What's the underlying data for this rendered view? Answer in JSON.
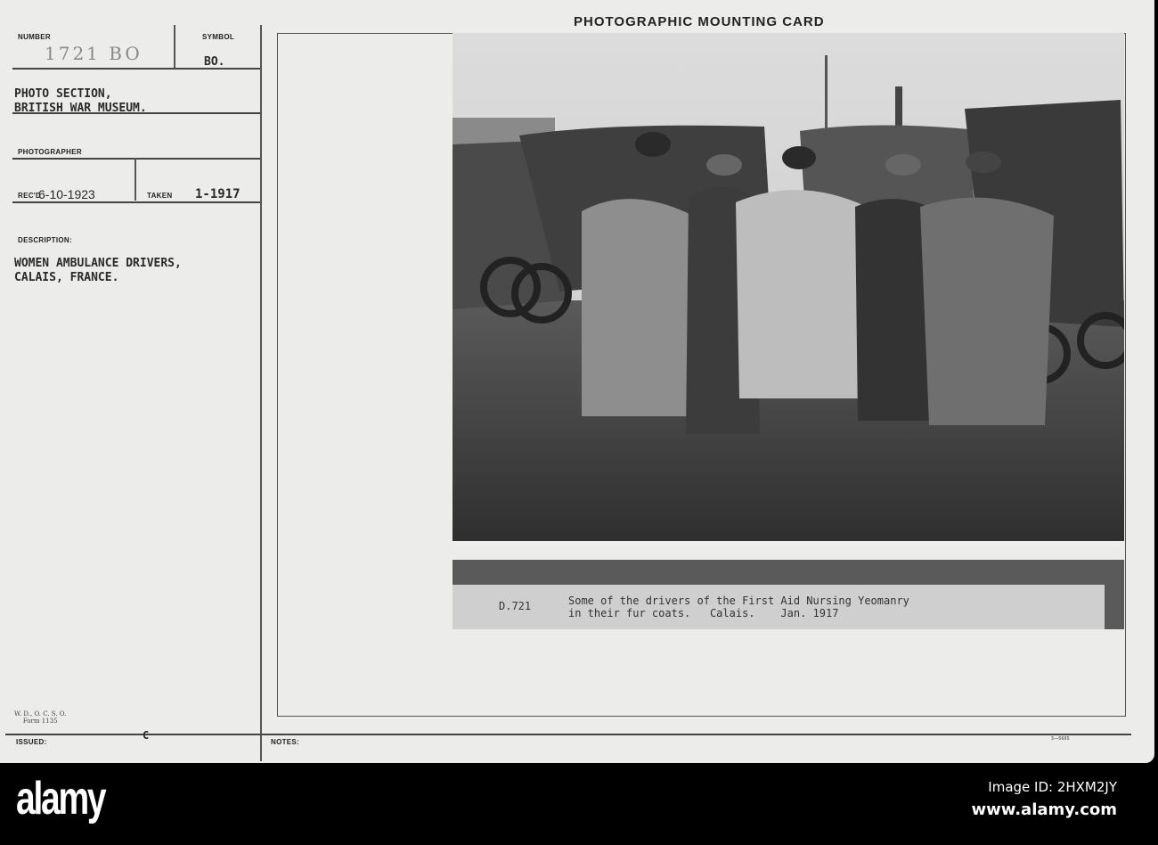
{
  "card": {
    "title": "PHOTOGRAPHIC MOUNTING CARD",
    "number_label": "NUMBER",
    "number_value": "1721 BO",
    "symbol_label": "SYMBOL",
    "symbol_value": "BO.",
    "source_line1": "PHOTO SECTION,",
    "source_line2": "BRITISH WAR MUSEUM.",
    "photographer_label": "PHOTOGRAPHER",
    "received_label": "REC'D",
    "received_value": "6-10-1923",
    "taken_label": "TAKEN",
    "taken_value": "1-1917",
    "description_label": "DESCRIPTION:",
    "description_line1": "WOMEN AMBULANCE DRIVERS,",
    "description_line2": "CALAIS, FRANCE.",
    "form_line1": "W. D., O. C. S. O.",
    "form_line2": "Form 1135",
    "issued_label": "ISSUED:",
    "issued_value": "C",
    "notes_label": "NOTES:",
    "print_code": "3—5605"
  },
  "caption": {
    "ref": "D.721",
    "line1": "Some of the drivers of the First Aid Nursing Yeomanry",
    "line2": "in their fur coats.   Calais.    Jan. 1917"
  },
  "watermark": {
    "logo": "alamy",
    "image_id": "Image ID: 2HXM2JY",
    "url": "www.alamy.com"
  }
}
